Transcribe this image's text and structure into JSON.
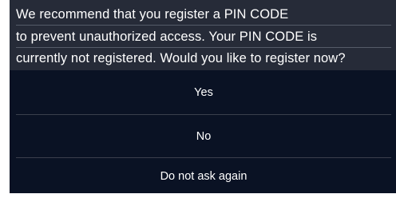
{
  "dialog": {
    "message_lines": [
      "We recommend that you register a PIN CODE",
      "to prevent unauthorized access. Your PIN CODE is",
      "currently not registered. Would you like to register now?"
    ],
    "options": {
      "yes": "Yes",
      "no": "No",
      "never": "Do not ask again"
    }
  }
}
